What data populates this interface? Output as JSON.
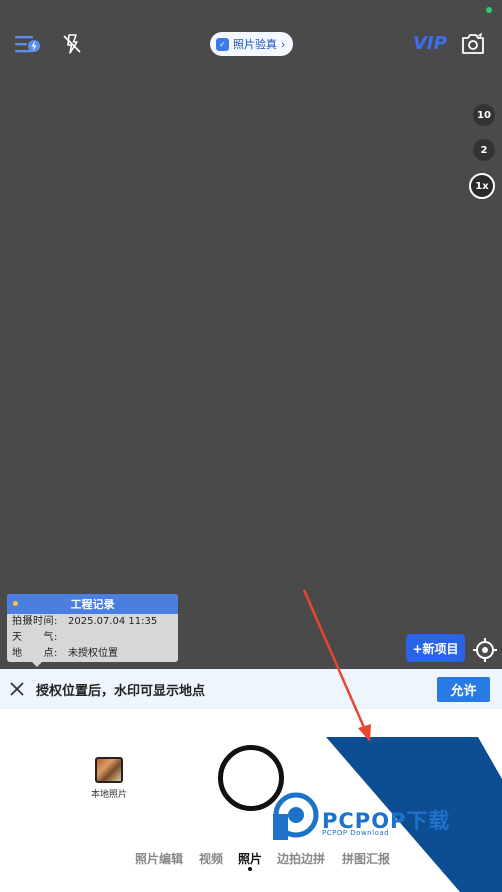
{
  "top_bar": {
    "verify_label": "照片验真",
    "verify_chevron": "›",
    "vip_label": "VIP",
    "icons": [
      "menu-lightning-icon",
      "flash-off-icon",
      "camera-switch-icon"
    ]
  },
  "zoom": {
    "levels": [
      "10",
      "2",
      "1x"
    ],
    "active": "1x"
  },
  "watermark": {
    "title": "工程记录",
    "rows": [
      {
        "key": "拍摄时间:",
        "value": "2025.07.04 11:35"
      },
      {
        "key": "天　　气:",
        "value": ""
      },
      {
        "key": "地　　点:",
        "value": "未授权位置"
      }
    ]
  },
  "new_project_label": "+新项目",
  "notice": {
    "text": "授权位置后，水印可显示地点",
    "allow_label": "允许"
  },
  "local_photos_label": "本地照片",
  "modes": {
    "items": [
      "照片编辑",
      "视频",
      "照片",
      "边拍边拼",
      "拼图汇报"
    ],
    "active": "照片"
  },
  "brand": {
    "name": "PCPOP下载",
    "sub": "PCPOP Download"
  },
  "colors": {
    "accent": "#2a64e6",
    "viewfinder": "#4a4a4a",
    "wedge": "#0d4d93",
    "arrow": "#e8472e"
  }
}
